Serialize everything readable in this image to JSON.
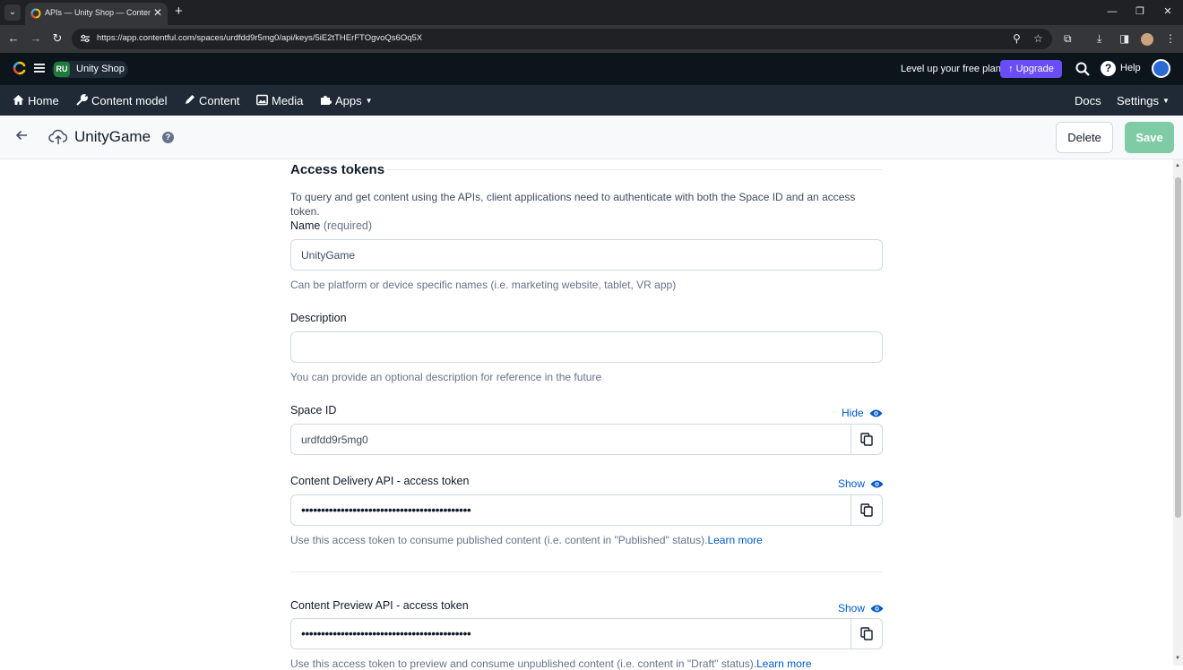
{
  "browser": {
    "tab_title": "APIs — Unity Shop — Contentful",
    "url": "https://app.contentful.com/spaces/urdfdd9r5mg0/api/keys/5iE2tTHErFTOgvoQs6Oq5X"
  },
  "app_header": {
    "space_initials": "RU",
    "space_name": "Unity Shop",
    "level_up_text": "Level up your free plan",
    "upgrade_label": "↑ Upgrade",
    "help_label": "Help",
    "badge_color": "#1f7a3a"
  },
  "nav": {
    "home": "Home",
    "content_model": "Content model",
    "content": "Content",
    "media": "Media",
    "apps": "Apps",
    "docs": "Docs",
    "settings": "Settings"
  },
  "entity": {
    "title": "UnityGame",
    "delete_label": "Delete",
    "save_label": "Save"
  },
  "form": {
    "section_title": "Access tokens",
    "intro": "To query and get content using the APIs, client applications need to authenticate with both the Space ID and an access token.",
    "name": {
      "label": "Name",
      "required": "(required)",
      "value": "UnityGame",
      "help": "Can be platform or device specific names (i.e. marketing website, tablet, VR app)"
    },
    "description": {
      "label": "Description",
      "value": "",
      "help": "You can provide an optional description for reference in the future"
    },
    "space_id": {
      "label": "Space ID",
      "toggle": "Hide",
      "value": "urdfdd9r5mg0"
    },
    "cda_token": {
      "label": "Content Delivery API - access token",
      "toggle": "Show",
      "masked_value": "•••••••••••••••••••••••••••••••••••••••••••",
      "help": "Use this access token to consume published content (i.e. content in \"Published\" status).",
      "link": "Learn more"
    },
    "cpa_token": {
      "label": "Content Preview API - access token",
      "toggle": "Show",
      "masked_value": "•••••••••••••••••••••••••••••••••••••••••••",
      "help": "Use this access token to preview and consume unpublished content (i.e. content in \"Draft\" status).",
      "link": "Learn more"
    }
  },
  "colors": {
    "primary_link": "#0059c8",
    "upgrade": "#6a4df5",
    "save_disabled": "#7ecba5",
    "header_bg": "#0c141c",
    "nav_bg": "#1f2a36"
  }
}
